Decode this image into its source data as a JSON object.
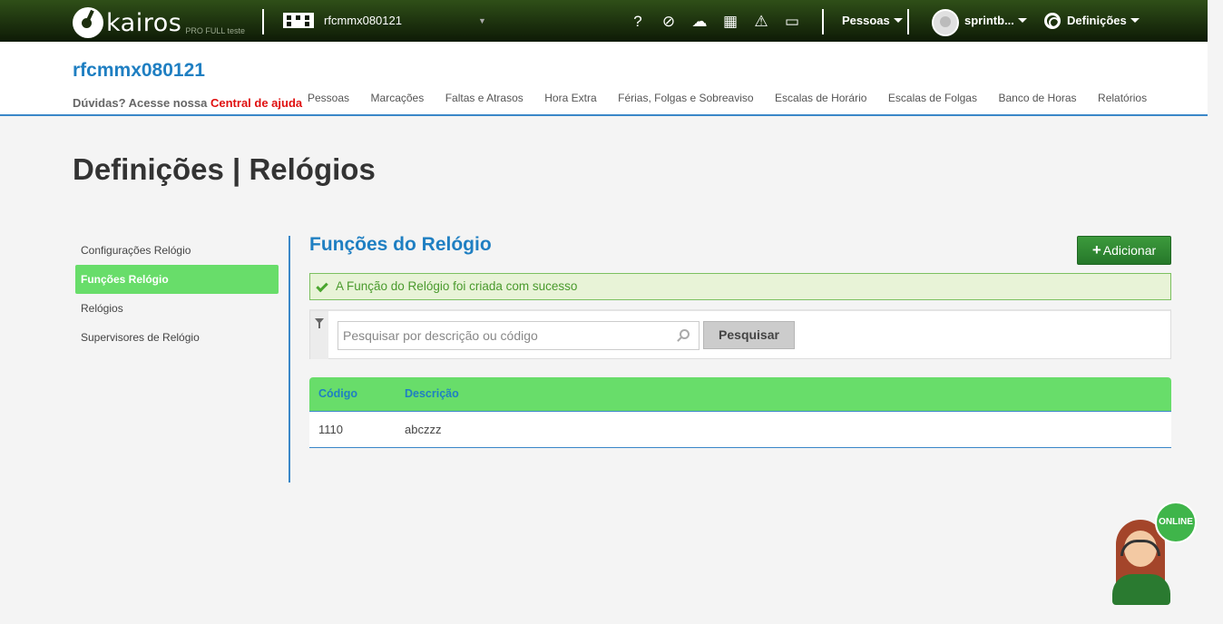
{
  "topbar": {
    "logo_text": "kairos",
    "logo_sub": "PRO FULL teste",
    "company_name": "rfcmmx080121",
    "icons": [
      "help-icon",
      "no-entry-icon",
      "cloud-upload-icon",
      "calculator-icon",
      "warning-icon",
      "inbox-icon"
    ],
    "people_menu": "Pessoas",
    "user_name": "sprintb...",
    "settings_menu": "Definições"
  },
  "header": {
    "company_title": "rfcmmx080121",
    "help_prefix": "Dúvidas? Acesse nossa",
    "help_link": "Central de ajuda",
    "nav": [
      "Pessoas",
      "Marcações",
      "Faltas e Atrasos",
      "Hora Extra",
      "Férias, Folgas e Sobreaviso",
      "Escalas de Horário",
      "Escalas de Folgas",
      "Banco de Horas",
      "Relatórios"
    ]
  },
  "page": {
    "title": "Definições | Relógios"
  },
  "side_menu": {
    "items": [
      {
        "label": "Configurações Relógio",
        "active": false
      },
      {
        "label": "Funções Relógio",
        "active": true
      },
      {
        "label": "Relógios",
        "active": false
      },
      {
        "label": "Supervisores de Relógio",
        "active": false
      }
    ]
  },
  "main": {
    "section_title": "Funções do Relógio",
    "add_button": "Adicionar",
    "alert": "A Função do Relógio foi criada com sucesso",
    "search": {
      "placeholder": "Pesquisar por descrição ou código",
      "value": "",
      "button": "Pesquisar"
    },
    "table": {
      "columns": [
        "Código",
        "Descrição"
      ],
      "rows": [
        [
          "1110",
          "abczzz"
        ]
      ]
    }
  },
  "chat": {
    "status": "ONLINE"
  },
  "colors": {
    "accent_blue": "#1f7fc2",
    "accent_green": "#68dd6a",
    "help_red": "#e01010"
  }
}
